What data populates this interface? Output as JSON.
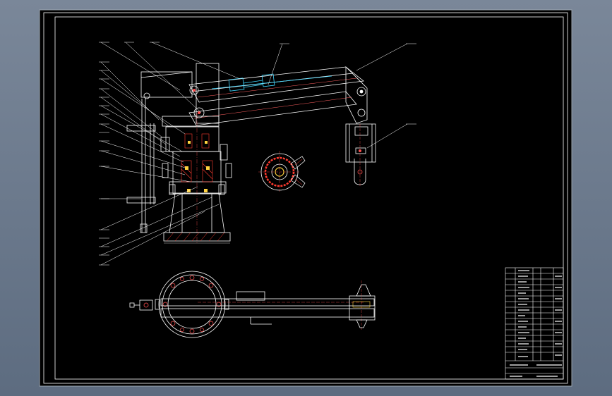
{
  "drawing": {
    "background": "#000000",
    "border_color": "#ffffff",
    "line_colors": {
      "outline": "#ffffff",
      "leader": "#ffffff",
      "hatch": "#ff3b2f",
      "section": "#ffd23f",
      "hidden": "#3fd7ff",
      "accent": "#ff4d4d"
    },
    "views": {
      "front": "arm-elevation-view",
      "section": "gripper-cross-section",
      "plan": "plan-view"
    },
    "title_block": {
      "rows": 18
    }
  }
}
